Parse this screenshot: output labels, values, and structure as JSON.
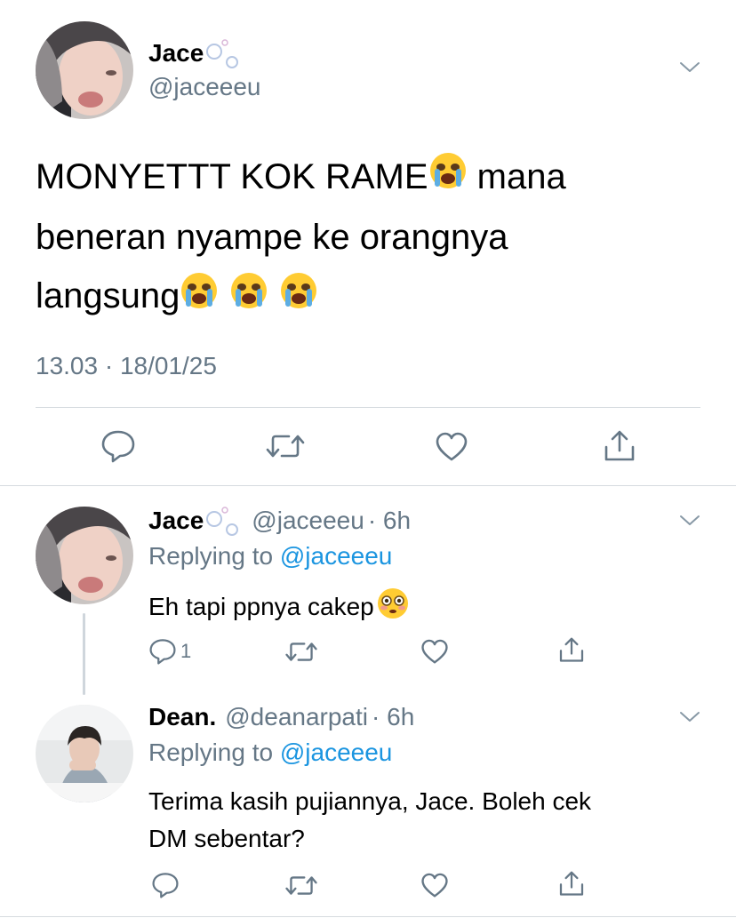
{
  "main_tweet": {
    "author_name": "Jace",
    "author_handle": "@jaceeeu",
    "text_line1": "MONYETTT KOK RAME",
    "text_line1b": " mana",
    "text_line2": "beneran nyampe ke orangnya",
    "text_line3": "langsung",
    "timestamp": "13.03 · 18/01/25"
  },
  "replies": [
    {
      "author_name": "Jace",
      "author_handle": "@jaceeeu",
      "time": "· 6h",
      "replying_prefix": "Replying to ",
      "replying_handle": "@jaceeeu",
      "text": "Eh tapi ppnya cakep",
      "reply_count": "1"
    },
    {
      "author_name": "Dean.",
      "author_handle": "@deanarpati",
      "time": "· 6h",
      "replying_prefix": "Replying to ",
      "replying_handle": "@jaceeeu",
      "text_line1": "Terima kasih pujiannya, Jace. Boleh cek",
      "text_line2": "DM sebentar?"
    }
  ],
  "icons": [
    "chevron-down-icon",
    "reply-icon",
    "retweet-icon",
    "like-icon",
    "share-icon",
    "bubbles-icon",
    "crying-face-emoji",
    "flushed-face-emoji"
  ],
  "colors": {
    "link": "#1b95e0",
    "muted": "#657786",
    "divider": "#d6dbdf"
  }
}
